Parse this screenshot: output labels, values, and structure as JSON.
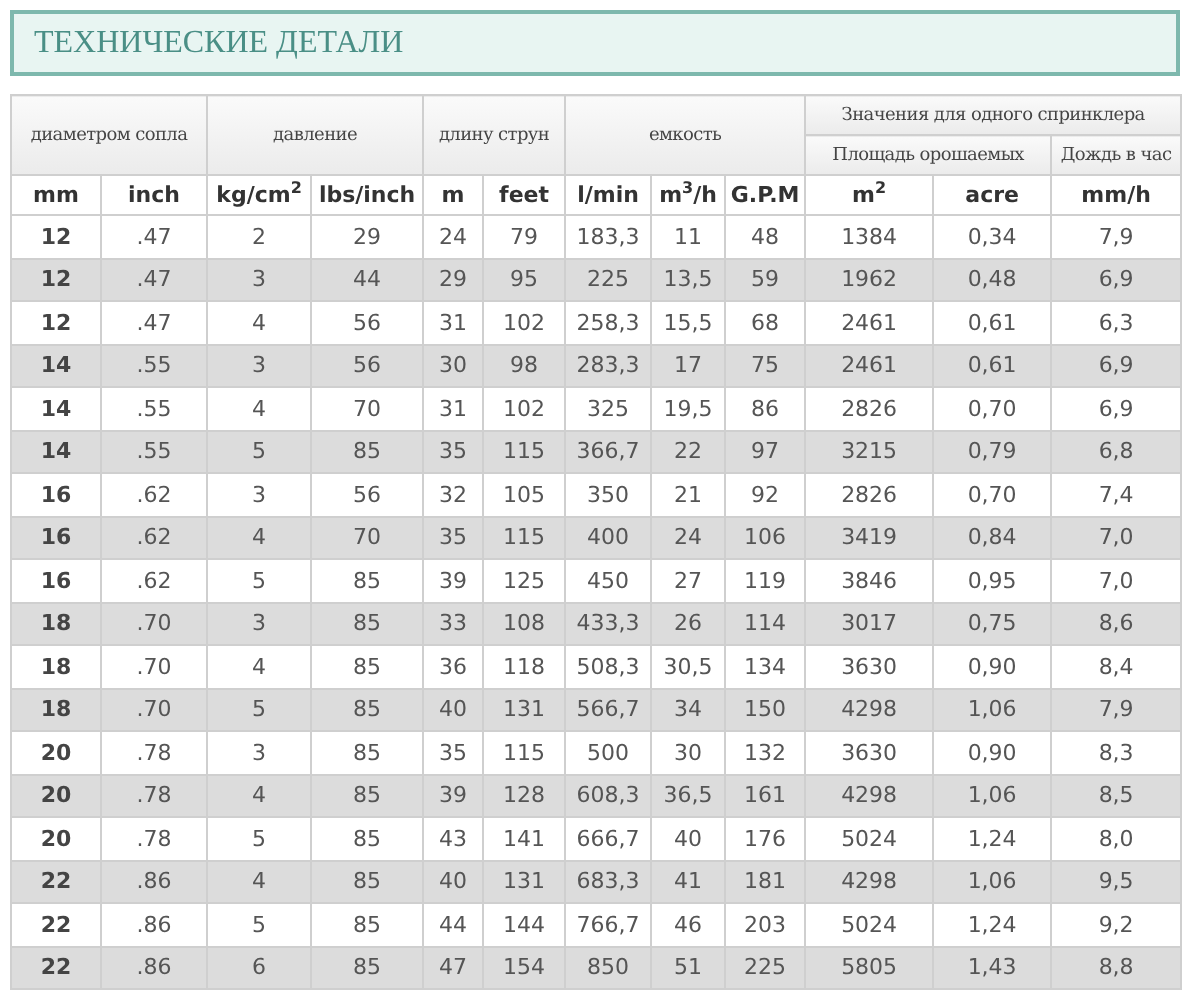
{
  "title": "ТЕХНИЧЕСКИЕ ДЕТАЛИ",
  "columns": [
    {
      "label": "диаметром сопла",
      "units": [
        "mm",
        "inch"
      ]
    },
    {
      "label": "давление",
      "units": [
        "kg/cm$^{2}$",
        "lbs/inch"
      ]
    },
    {
      "label": "длину струн",
      "units": [
        "m",
        "feet"
      ]
    },
    {
      "label": "емкость",
      "units": [
        "l/min",
        "m$^{3}$/h",
        "G.P.M"
      ]
    }
  ],
  "per_sprinkler": {
    "label": "Значения для одного спринклера",
    "groups": [
      {
        "label": "Площадь орошаемых",
        "units": [
          "m$^{2}$",
          "acre"
        ]
      },
      {
        "label": "Дождь в час",
        "units": [
          "mm/h"
        ]
      }
    ]
  },
  "rows": [
    [
      "12",
      ".47",
      "2",
      "29",
      "24",
      "79",
      "183,3",
      "11",
      "48",
      "1384",
      "0,34",
      "7,9"
    ],
    [
      "12",
      ".47",
      "3",
      "44",
      "29",
      "95",
      "225",
      "13,5",
      "59",
      "1962",
      "0,48",
      "6,9"
    ],
    [
      "12",
      ".47",
      "4",
      "56",
      "31",
      "102",
      "258,3",
      "15,5",
      "68",
      "2461",
      "0,61",
      "6,3"
    ],
    [
      "14",
      ".55",
      "3",
      "56",
      "30",
      "98",
      "283,3",
      "17",
      "75",
      "2461",
      "0,61",
      "6,9"
    ],
    [
      "14",
      ".55",
      "4",
      "70",
      "31",
      "102",
      "325",
      "19,5",
      "86",
      "2826",
      "0,70",
      "6,9"
    ],
    [
      "14",
      ".55",
      "5",
      "85",
      "35",
      "115",
      "366,7",
      "22",
      "97",
      "3215",
      "0,79",
      "6,8"
    ],
    [
      "16",
      ".62",
      "3",
      "56",
      "32",
      "105",
      "350",
      "21",
      "92",
      "2826",
      "0,70",
      "7,4"
    ],
    [
      "16",
      ".62",
      "4",
      "70",
      "35",
      "115",
      "400",
      "24",
      "106",
      "3419",
      "0,84",
      "7,0"
    ],
    [
      "16",
      ".62",
      "5",
      "85",
      "39",
      "125",
      "450",
      "27",
      "119",
      "3846",
      "0,95",
      "7,0"
    ],
    [
      "18",
      ".70",
      "3",
      "85",
      "33",
      "108",
      "433,3",
      "26",
      "114",
      "3017",
      "0,75",
      "8,6"
    ],
    [
      "18",
      ".70",
      "4",
      "85",
      "36",
      "118",
      "508,3",
      "30,5",
      "134",
      "3630",
      "0,90",
      "8,4"
    ],
    [
      "18",
      ".70",
      "5",
      "85",
      "40",
      "131",
      "566,7",
      "34",
      "150",
      "4298",
      "1,06",
      "7,9"
    ],
    [
      "20",
      ".78",
      "3",
      "85",
      "35",
      "115",
      "500",
      "30",
      "132",
      "3630",
      "0,90",
      "8,3"
    ],
    [
      "20",
      ".78",
      "4",
      "85",
      "39",
      "128",
      "608,3",
      "36,5",
      "161",
      "4298",
      "1,06",
      "8,5"
    ],
    [
      "20",
      ".78",
      "5",
      "85",
      "43",
      "141",
      "666,7",
      "40",
      "176",
      "5024",
      "1,24",
      "8,0"
    ],
    [
      "22",
      ".86",
      "4",
      "85",
      "40",
      "131",
      "683,3",
      "41",
      "181",
      "4298",
      "1,06",
      "9,5"
    ],
    [
      "22",
      ".86",
      "5",
      "85",
      "44",
      "144",
      "766,7",
      "46",
      "203",
      "5024",
      "1,24",
      "9,2"
    ],
    [
      "22",
      ".86",
      "6",
      "85",
      "47",
      "154",
      "850",
      "51",
      "225",
      "5805",
      "1,43",
      "8,8"
    ]
  ]
}
